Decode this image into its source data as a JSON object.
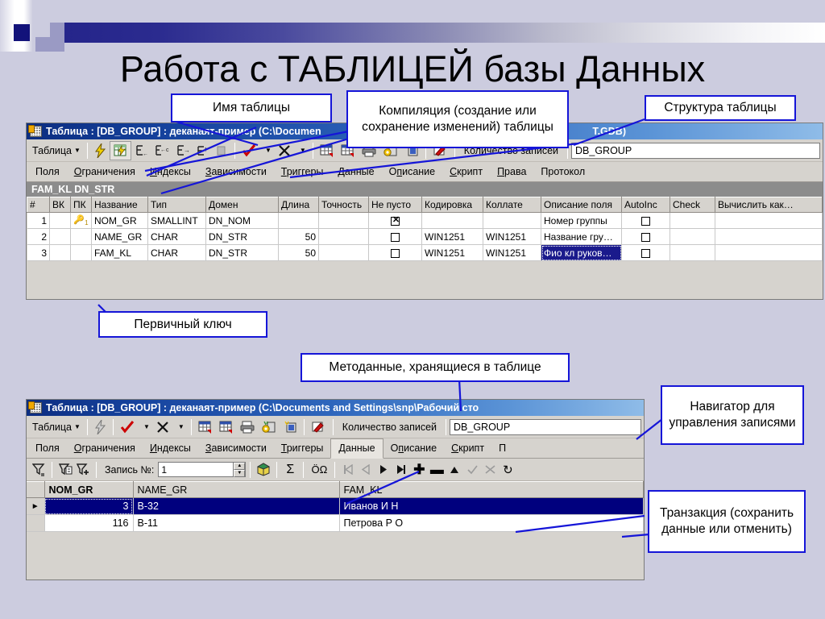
{
  "slide": {
    "title": "Работа с ТАБЛИЦЕЙ базы Данных",
    "background_color": "#ccccdf",
    "accent_color": "#1515d8",
    "title_bar_color": "#16439e"
  },
  "callouts": [
    {
      "id": "table-name",
      "text": "Имя таблицы"
    },
    {
      "id": "compilation",
      "text": "Компиляция (создание или сохранение изменений) таблицы"
    },
    {
      "id": "structure",
      "text": "Структура таблицы"
    },
    {
      "id": "primary-key",
      "text": "Первичный ключ"
    },
    {
      "id": "metadata",
      "text": "Методанные, хранящиеся в таблице"
    },
    {
      "id": "navigator",
      "text": "Навигатор для управления записями"
    },
    {
      "id": "transaction",
      "text": "Транзакция (сохранить данные или отменить)"
    }
  ],
  "window_structure": {
    "title": "Таблица : [DB_GROUP] : деканаят-пример (C:\\Documen",
    "title_tail": "T.GDB)",
    "toolbar": {
      "menu_label": "Таблица",
      "icons": [
        "lightning-icon",
        "compile-table-icon",
        "insert-field-icon",
        "insert-field-before-icon",
        "append-field-icon",
        "move-field-up-icon",
        "delete-field-icon",
        "commit-check-icon",
        "rollback-x-icon",
        "grid-data-icon",
        "grid-data-alt-icon",
        "print-icon",
        "settings-gold-icon",
        "settings-blue-icon",
        "paint-icon"
      ],
      "records_label": "Количество записей",
      "combo_value": "DB_GROUP"
    },
    "tabs": [
      {
        "label": "Поля",
        "underline": "",
        "active": false
      },
      {
        "label": "Ограничения",
        "underline": "О",
        "active": false
      },
      {
        "label": "Индексы",
        "underline": "И",
        "active": false
      },
      {
        "label": "Зависимости",
        "underline": "З",
        "active": false
      },
      {
        "label": "Триггеры",
        "underline": "Т",
        "active": false
      },
      {
        "label": "Данные",
        "underline": "Д",
        "active": false
      },
      {
        "label": "Описание",
        "underline": "п",
        "active": false
      },
      {
        "label": "Скрипт",
        "underline": "С",
        "active": false
      },
      {
        "label": "Права",
        "underline": "П",
        "active": false
      },
      {
        "label": "Протокол",
        "underline": "",
        "active": false
      }
    ],
    "band": "FAM_KL DN_STR",
    "columns": [
      "#",
      "ВК",
      "ПК",
      "Название",
      "Тип",
      "Домен",
      "Длина",
      "Точность",
      "Не пусто",
      "Кодировка",
      "Коллате",
      "Описание поля",
      "AutoInc",
      "Check",
      "Вычислить как…"
    ],
    "rows": [
      {
        "num": "1",
        "vk": "",
        "pk": "key",
        "name": "NOM_GR",
        "type": "SMALLINT",
        "domain": "DN_NOM",
        "len": "",
        "prec": "",
        "notnull": true,
        "charset": "",
        "collate": "",
        "descr": "Номер группы",
        "autoinc": false,
        "check": "",
        "computed": "",
        "descr_selected": false
      },
      {
        "num": "2",
        "vk": "",
        "pk": "",
        "name": "NAME_GR",
        "type": "CHAR",
        "domain": "DN_STR",
        "len": "50",
        "prec": "",
        "notnull": false,
        "charset": "WIN1251",
        "collate": "WIN1251",
        "descr": "Название гру…",
        "autoinc": false,
        "check": "",
        "computed": "",
        "descr_selected": false
      },
      {
        "num": "3",
        "vk": "",
        "pk": "",
        "name": "FAM_KL",
        "type": "CHAR",
        "domain": "DN_STR",
        "len": "50",
        "prec": "",
        "notnull": false,
        "charset": "WIN1251",
        "collate": "WIN1251",
        "descr": "Фио кл руков…",
        "autoinc": false,
        "check": "",
        "computed": "",
        "descr_selected": true
      }
    ]
  },
  "window_data": {
    "title": "Таблица : [DB_GROUP] : деканаят-пример (C:\\Documents and Settings\\snp\\Рабочий сто",
    "toolbar": {
      "menu_label": "Таблица",
      "icons": [
        "lightning-icon",
        "commit-check-icon",
        "rollback-x-icon",
        "grid-data-icon",
        "grid-data-alt-icon",
        "print-icon",
        "settings-gold-icon",
        "settings-blue-icon",
        "paint-icon"
      ],
      "records_label": "Количество записей",
      "combo_value": "DB_GROUP"
    },
    "tabs": [
      {
        "label": "Поля",
        "underline": "",
        "active": false
      },
      {
        "label": "Ограничения",
        "underline": "О",
        "active": false
      },
      {
        "label": "Индексы",
        "underline": "И",
        "active": false
      },
      {
        "label": "Зависимости",
        "underline": "З",
        "active": false
      },
      {
        "label": "Триггеры",
        "underline": "Т",
        "active": false
      },
      {
        "label": "Данные",
        "underline": "Д",
        "active": true
      },
      {
        "label": "Описание",
        "underline": "п",
        "active": false
      },
      {
        "label": "Скрипт",
        "underline": "С",
        "active": false
      },
      {
        "label": "П",
        "underline": "",
        "active": false
      }
    ],
    "navigator": {
      "filter_icons": [
        "filter-clear-icon",
        "filter-list-icon",
        "filter-add-icon"
      ],
      "record_label": "Запись №:",
      "record_value": "1",
      "cube_icon": "cube-icon",
      "sum_icon": "sigma-icon",
      "charset_icon": "char-omega-icon",
      "buttons": [
        "first-record-icon",
        "prev-record-icon",
        "next-record-icon",
        "last-record-icon",
        "insert-record-icon",
        "delete-record-icon",
        "edit-record-icon",
        "post-record-icon",
        "cancel-record-icon",
        "refresh-record-icon"
      ]
    },
    "columns": [
      "NOM_GR",
      "NAME_GR",
      "FAM_KL"
    ],
    "rows": [
      {
        "nom_gr": "3",
        "name_gr": "B-32",
        "fam_kl": "Иванов И Н",
        "selected": true
      },
      {
        "nom_gr": "116",
        "name_gr": "B-11",
        "fam_kl": "Петрова Р О",
        "selected": false
      }
    ]
  }
}
